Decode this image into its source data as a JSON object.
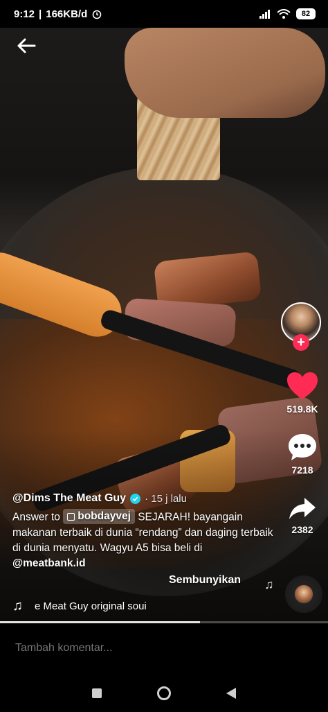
{
  "status_bar": {
    "time": "9:12",
    "network_speed": "166KB/d",
    "battery": "82",
    "icons": [
      "alarm-icon",
      "signal-icon",
      "wifi-icon",
      "battery-icon"
    ]
  },
  "video": {
    "progress_fraction": 0.61
  },
  "author": {
    "name": "@Dims The Meat Guy",
    "verified": true,
    "posted": "· 15 j lalu"
  },
  "caption": {
    "prefix": "Answer to",
    "mention": "bobdayvej",
    "text": "SEJARAH! bayangain makanan terbaik di dunia “rendang” dan daging terbaik di dunia menyatu. Wagyu A5 bisa beli di",
    "link": "@meatbank.id",
    "hide_label": "Sembunyikan"
  },
  "music": {
    "text": "e Meat Guy    original soui"
  },
  "actions": {
    "likes": "519.8K",
    "comments": "7218",
    "shares": "2382",
    "like_color": "#fe2c55"
  },
  "comment_bar": {
    "placeholder": "Tambah komentar..."
  }
}
